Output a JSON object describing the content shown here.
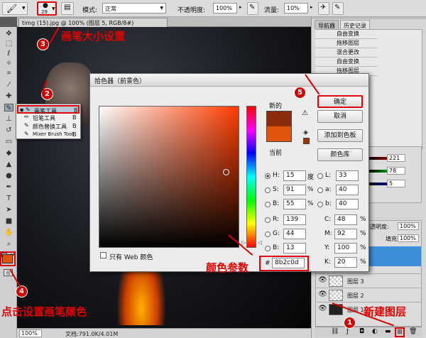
{
  "options_bar": {
    "brush_size": "29",
    "mode_label": "模式:",
    "mode_value": "正常",
    "opacity_label": "不透明度:",
    "opacity_value": "100%",
    "flow_label": "流量:",
    "flow_value": "10%"
  },
  "document_tab": "timg (15).jpg @ 100% (图层 5, RGB/8#)",
  "status_bar": {
    "zoom": "100%",
    "doc_info": "文档:791.0K/4.01M"
  },
  "tool_menu": {
    "items": [
      {
        "label": "画笔工具",
        "key": "B"
      },
      {
        "label": "铅笔工具",
        "key": "B"
      },
      {
        "label": "颜色替换工具",
        "key": "B"
      },
      {
        "label": "Mixer Brush Tool",
        "key": "B"
      }
    ]
  },
  "panels": {
    "tab_navigator": "导航器",
    "tab_history": "历史记录",
    "history": [
      "自由变换",
      "拖移图层",
      "混合更改",
      "自由变换",
      "拖移图层"
    ],
    "color_values": [
      "221",
      "78",
      "5"
    ],
    "layers_opacity_label": "不透明度:",
    "layers_opacity_value": "100%",
    "fill_label": "填充:",
    "fill_value": "100%",
    "layers": [
      "图层 3",
      "图层 2",
      "图层 1"
    ]
  },
  "picker": {
    "title": "拾色器（前景色）",
    "new_label": "新的",
    "current_label": "当前",
    "ok": "确定",
    "cancel": "取消",
    "add_swatch": "添加到色板",
    "color_libraries": "颜色库",
    "web_only": "只有 Web 颜色",
    "hsb": [
      {
        "l": "H:",
        "v": "15",
        "u": "度"
      },
      {
        "l": "S:",
        "v": "91",
        "u": "%"
      },
      {
        "l": "B:",
        "v": "55",
        "u": "%"
      }
    ],
    "rgb": [
      {
        "l": "R:",
        "v": "139"
      },
      {
        "l": "G:",
        "v": "44"
      },
      {
        "l": "B:",
        "v": "13"
      }
    ],
    "lab": [
      {
        "l": "L:",
        "v": "33"
      },
      {
        "l": "a:",
        "v": "40"
      },
      {
        "l": "b:",
        "v": "40"
      }
    ],
    "cmyk": [
      {
        "l": "C:",
        "v": "48",
        "u": "%"
      },
      {
        "l": "M:",
        "v": "92",
        "u": "%"
      },
      {
        "l": "Y:",
        "v": "100",
        "u": "%"
      },
      {
        "l": "K:",
        "v": "20",
        "u": "%"
      }
    ],
    "hex_label": "#",
    "hex_value": "8b2c0d",
    "new_color": "#8b2c0d",
    "current_color": "#e0540c"
  },
  "annotations": {
    "brush_size_setting": "画笔大小设置",
    "color_params": "颜色参数",
    "set_brush_color": "点击设置画笔颜色",
    "new_layer": "新建图层",
    "badges": [
      "1",
      "2",
      "3",
      "4",
      "5"
    ]
  },
  "colors": {
    "accent_red": "#e00000",
    "foreground": "#e0540c",
    "selected_layer": "#3d8fd8"
  }
}
